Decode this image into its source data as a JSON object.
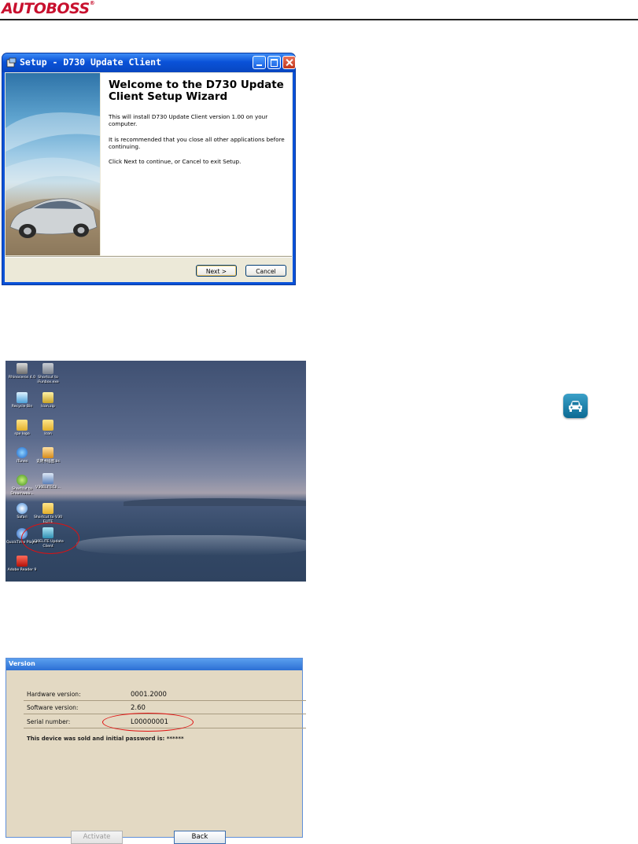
{
  "header": {
    "brand": "AUTOBOSS",
    "registered_mark": "®"
  },
  "setup_window": {
    "title": "Setup - D730 Update Client",
    "heading": "Welcome to the D730 Update Client Setup Wizard",
    "paragraph_1": "This will install D730 Update Client version 1.00 on your computer.",
    "paragraph_2": "It is recommended that you close all other applications before continuing.",
    "paragraph_3": "Click Next to continue, or Cancel to exit Setup.",
    "next_button": "Next >",
    "cancel_button": "Cancel"
  },
  "desktop": {
    "icons": [
      {
        "label": "Rhinoceros 4.0",
        "icon": "rhino-icon"
      },
      {
        "label": "Shortcut to iFunbox.exe",
        "icon": "iphone-icon"
      },
      {
        "label": "Recycle Bin",
        "icon": "recycle-bin-icon"
      },
      {
        "label": "Icon.zip",
        "icon": "zip-icon"
      },
      {
        "label": "spx logo",
        "icon": "folder-icon"
      },
      {
        "label": "Icon",
        "icon": "folder-icon"
      },
      {
        "label": "iTunes",
        "icon": "itunes-icon"
      },
      {
        "label": "说明书插图.bs",
        "icon": "document-icon"
      },
      {
        "label": "Shortcut to Dreamwea...",
        "icon": "dreamweaver-icon"
      },
      {
        "label": "V30ELITECli...",
        "icon": "installer-icon"
      },
      {
        "label": "Safari",
        "icon": "safari-icon"
      },
      {
        "label": "Shortcut to V30 ELITE",
        "icon": "folder-icon"
      },
      {
        "label": "QuickTime Player",
        "icon": "quicktime-icon"
      },
      {
        "label": "V30ELITE Update Client",
        "icon": "update-client-icon"
      },
      {
        "label": "Adobe Reader 9",
        "icon": "adobe-reader-icon"
      }
    ],
    "highlight_color": "#e01010"
  },
  "side_icon": {
    "name": "car-diagnostic-app-icon"
  },
  "version_panel": {
    "title": "Version",
    "rows": [
      {
        "label": "Hardware version:",
        "value": "0001.2000"
      },
      {
        "label": "Software version:",
        "value": "2.60"
      },
      {
        "label": "Serial number:",
        "value": "L00000001"
      }
    ],
    "note": "This device was sold and initial password is: ******",
    "activate_button": "Activate",
    "back_button": "Back"
  }
}
